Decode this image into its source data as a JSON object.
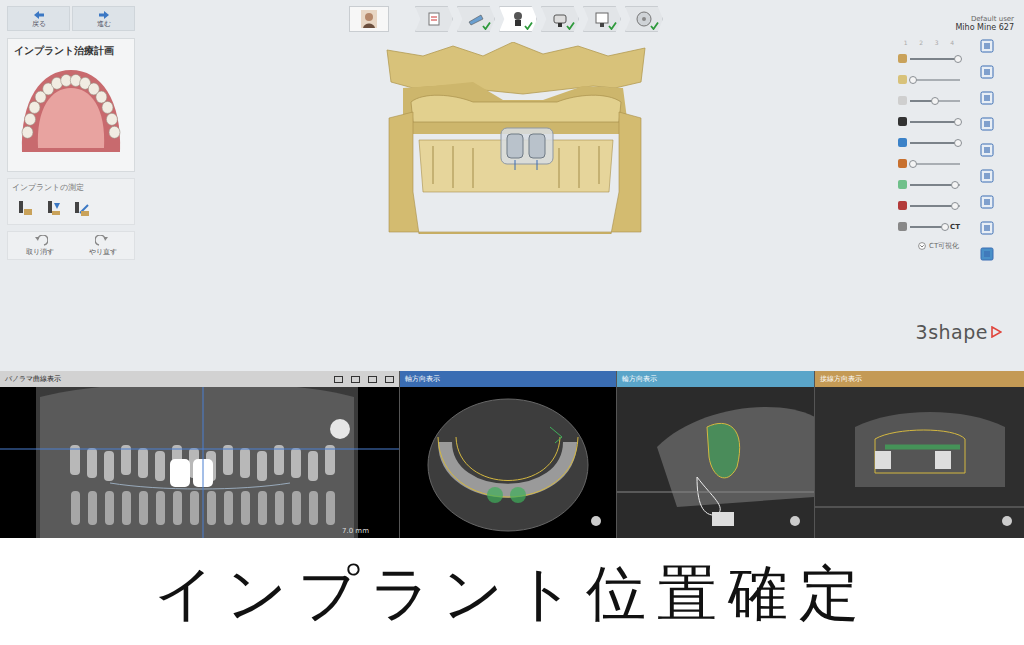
{
  "nav": [
    {
      "label": "戻る"
    },
    {
      "label": "進む"
    }
  ],
  "plan_card": {
    "title": "インプラント治療計画"
  },
  "measure": {
    "title": "インプラントの測定"
  },
  "history": [
    {
      "label": "取り消す"
    },
    {
      "label": "やり直す"
    }
  ],
  "workflow": [
    {
      "kind": "patient",
      "selected": false,
      "done": false
    },
    {
      "kind": "step",
      "selected": false,
      "done": false
    },
    {
      "kind": "step",
      "selected": false,
      "done": true
    },
    {
      "kind": "step",
      "selected": true,
      "done": true
    },
    {
      "kind": "step",
      "selected": false,
      "done": true
    },
    {
      "kind": "step",
      "selected": false,
      "done": true
    },
    {
      "kind": "step",
      "selected": false,
      "done": true
    }
  ],
  "user": {
    "role": "Default user",
    "name": "Miho Mine 627"
  },
  "slider_scale": [
    "1",
    "2",
    "3",
    "4"
  ],
  "sliders": [
    {
      "level": 0.95
    },
    {
      "level": 0.05
    },
    {
      "level": 0.5
    },
    {
      "level": 0.95
    },
    {
      "level": 0.95
    },
    {
      "level": 0.05
    },
    {
      "level": 0.9
    },
    {
      "level": 0.9
    },
    {
      "level": 0.95,
      "label": "CT"
    }
  ],
  "ct_toggle": {
    "label": "CT可視化"
  },
  "logo": {
    "text": "3shape"
  },
  "viewers": [
    {
      "title": "パノラマ曲線表示",
      "kind": "panorama",
      "color": "#d2d2d2",
      "scale": "7.0 mm"
    },
    {
      "title": "軸方向表示",
      "kind": "axial",
      "color": "#3a6db3"
    },
    {
      "title": "輪方向表示",
      "kind": "transverse",
      "color": "#5aa5c9"
    },
    {
      "title": "接線方向表示",
      "kind": "tangential",
      "color": "#c49a55"
    }
  ],
  "caption": "インプラント位置確定"
}
